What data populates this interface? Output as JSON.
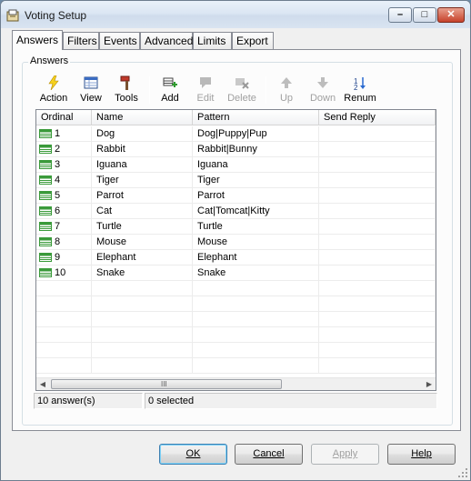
{
  "window": {
    "title": "Voting Setup",
    "caption_buttons": [
      "minimize",
      "maximize",
      "close"
    ]
  },
  "tabs": [
    {
      "label": "Answers",
      "active": true
    },
    {
      "label": "Filters"
    },
    {
      "label": "Events"
    },
    {
      "label": "Advanced"
    },
    {
      "label": "Limits"
    },
    {
      "label": "Export"
    }
  ],
  "group": {
    "label": "Answers"
  },
  "toolbar": {
    "action": "Action",
    "view": "View",
    "tools": "Tools",
    "add": "Add",
    "edit": "Edit",
    "delete": "Delete",
    "up": "Up",
    "down": "Down",
    "renum": "Renum"
  },
  "list": {
    "columns": [
      "Ordinal",
      "Name",
      "Pattern",
      "Send Reply"
    ],
    "rows": [
      {
        "ordinal": "1",
        "name": "Dog",
        "pattern": "Dog|Puppy|Pup",
        "send_reply": ""
      },
      {
        "ordinal": "2",
        "name": "Rabbit",
        "pattern": "Rabbit|Bunny",
        "send_reply": ""
      },
      {
        "ordinal": "3",
        "name": "Iguana",
        "pattern": "Iguana",
        "send_reply": ""
      },
      {
        "ordinal": "4",
        "name": "Tiger",
        "pattern": "Tiger",
        "send_reply": ""
      },
      {
        "ordinal": "5",
        "name": "Parrot",
        "pattern": "Parrot",
        "send_reply": ""
      },
      {
        "ordinal": "6",
        "name": "Cat",
        "pattern": "Cat|Tomcat|Kitty",
        "send_reply": ""
      },
      {
        "ordinal": "7",
        "name": "Turtle",
        "pattern": "Turtle",
        "send_reply": ""
      },
      {
        "ordinal": "8",
        "name": "Mouse",
        "pattern": "Mouse",
        "send_reply": ""
      },
      {
        "ordinal": "9",
        "name": "Elephant",
        "pattern": "Elephant",
        "send_reply": ""
      },
      {
        "ordinal": "10",
        "name": "Snake",
        "pattern": "Snake",
        "send_reply": ""
      }
    ],
    "scrollbar_grip": "III"
  },
  "status": {
    "count": "10 answer(s)",
    "selected": "0 selected"
  },
  "buttons": {
    "ok": "OK",
    "cancel": "Cancel",
    "apply": "Apply",
    "help": "Help"
  },
  "colors": {
    "row_icon": "#3a9a3a",
    "accent": "#3c7fb1"
  }
}
